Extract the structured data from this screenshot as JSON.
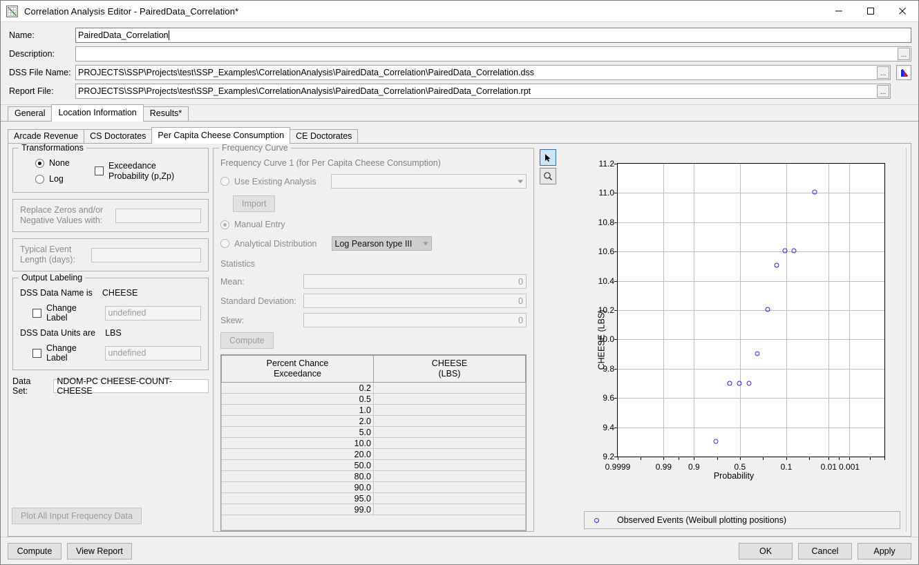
{
  "window": {
    "title": "Correlation Analysis Editor - PairedData_Correlation*",
    "icon": "correlation-chart-icon",
    "controls": {
      "minimize": "minimize-icon",
      "maximize": "maximize-icon",
      "close": "close-icon"
    }
  },
  "header": {
    "name_label": "Name:",
    "name_value": "PairedData_Correlation",
    "description_label": "Description:",
    "description_value": "",
    "dss_label": "DSS File Name:",
    "dss_value": "PROJECTS\\SSP\\Projects\\test\\SSP_Examples\\CorrelationAnalysis\\PairedData_Correlation\\PairedData_Correlation.dss",
    "report_label": "Report File:",
    "report_value": "PROJECTS\\SSP\\Projects\\test\\SSP_Examples\\CorrelationAnalysis\\PairedData_Correlation\\PairedData_Correlation.rpt",
    "browse_label": "...",
    "dist_icon": "distribution-plot-icon"
  },
  "main_tabs": [
    {
      "label": "General",
      "selected": false
    },
    {
      "label": "Location Information",
      "selected": true
    },
    {
      "label": "Results*",
      "selected": false
    }
  ],
  "sub_tabs": [
    {
      "label": "Arcade Revenue",
      "selected": false
    },
    {
      "label": "CS Doctorates",
      "selected": false
    },
    {
      "label": "Per Capita Cheese Consumption",
      "selected": true
    },
    {
      "label": "CE Doctorates",
      "selected": false
    }
  ],
  "transformations": {
    "group_label": "Transformations",
    "none_label": "None",
    "none_selected": true,
    "log_label": "Log",
    "log_selected": false,
    "exceedance_label_line1": "Exceedance",
    "exceedance_label_line2": "Probability (p,Zp)",
    "exceedance_checked": false
  },
  "replace_zeros": {
    "label_line1": "Replace Zeros and/or",
    "label_line2": "Negative Values with:",
    "value": ""
  },
  "typical_event": {
    "label_line1": "Typical Event",
    "label_line2": "Length (days):",
    "value": ""
  },
  "output_labeling": {
    "group_label": "Output Labeling",
    "data_name_label": "DSS Data Name is",
    "data_name_value": "CHEESE",
    "change_label_1": "Change Label",
    "change_label_1_checked": false,
    "change_label_1_value": "undefined",
    "data_units_label": "DSS Data Units are",
    "data_units_value": "LBS",
    "change_label_2": "Change Label",
    "change_label_2_checked": false,
    "change_label_2_value": "undefined"
  },
  "data_set": {
    "label": "Data Set:",
    "value": "NDOM-PC CHEESE-COUNT-CHEESE"
  },
  "plot_all_button": "Plot All Input Frequency Data",
  "frequency_curve": {
    "group_label": "Frequency Curve",
    "subtitle": "Frequency Curve 1 (for Per Capita Cheese Consumption)",
    "use_existing_label": "Use Existing Analysis",
    "use_existing_selected": false,
    "use_existing_value": "",
    "import_button": "Import",
    "manual_entry_label": "Manual Entry",
    "manual_entry_selected": true,
    "analytical_label": "Analytical Distribution",
    "analytical_selected": false,
    "distribution_value": "Log Pearson type III",
    "statistics_label": "Statistics",
    "mean_label": "Mean:",
    "mean_value": "0",
    "stddev_label": "Standard Deviation:",
    "stddev_value": "0",
    "skew_label": "Skew:",
    "skew_value": "0",
    "compute_button": "Compute"
  },
  "table": {
    "col1_header_line1": "Percent Chance",
    "col1_header_line2": "Exceedance",
    "col2_header_line1": "CHEESE",
    "col2_header_line2": "(LBS)",
    "rows": [
      {
        "pce": "0.2",
        "cheese": ""
      },
      {
        "pce": "0.5",
        "cheese": ""
      },
      {
        "pce": "1.0",
        "cheese": ""
      },
      {
        "pce": "2.0",
        "cheese": ""
      },
      {
        "pce": "5.0",
        "cheese": ""
      },
      {
        "pce": "10.0",
        "cheese": ""
      },
      {
        "pce": "20.0",
        "cheese": ""
      },
      {
        "pce": "50.0",
        "cheese": ""
      },
      {
        "pce": "80.0",
        "cheese": ""
      },
      {
        "pce": "90.0",
        "cheese": ""
      },
      {
        "pce": "95.0",
        "cheese": ""
      },
      {
        "pce": "99.0",
        "cheese": ""
      }
    ]
  },
  "chart_tools": [
    {
      "name": "pointer-tool",
      "selected": true
    },
    {
      "name": "zoom-tool",
      "selected": false
    }
  ],
  "chart_data": {
    "type": "scatter",
    "title": "",
    "xlabel": "Probability",
    "ylabel": "CHEESE (LBS)",
    "x_tick_labels": [
      "0.9999",
      "0.99",
      "0.9",
      "0.5",
      "0.1",
      "0.01",
      "0.001"
    ],
    "x_tick_positions": [
      0.0,
      0.172,
      0.286,
      0.458,
      0.632,
      0.791,
      0.868
    ],
    "y_tick_labels": [
      "9.2",
      "9.4",
      "9.6",
      "9.8",
      "10.0",
      "10.2",
      "10.4",
      "10.6",
      "10.8",
      "11.0",
      "11.2"
    ],
    "ylim": [
      9.2,
      11.2
    ],
    "grid": true,
    "legend_position": "bottom",
    "series": [
      {
        "name": "Observed Events (Weibull plotting positions)",
        "marker": "open-circle",
        "color": "#2727d6",
        "points": [
          {
            "probability": 0.9,
            "cheese": 9.3
          },
          {
            "probability": 0.8,
            "cheese": 9.7
          },
          {
            "probability": 0.7,
            "cheese": 9.7
          },
          {
            "probability": 0.6,
            "cheese": 9.7
          },
          {
            "probability": 0.5,
            "cheese": 9.9
          },
          {
            "probability": 0.45,
            "cheese": 10.2
          },
          {
            "probability": 0.35,
            "cheese": 10.5
          },
          {
            "probability": 0.27,
            "cheese": 10.6
          },
          {
            "probability": 0.22,
            "cheese": 10.6
          },
          {
            "probability": 0.1,
            "cheese": 11.0
          }
        ],
        "pixel_positions": [
          {
            "x": 0.367,
            "y": 9.305
          },
          {
            "x": 0.42,
            "y": 9.7
          },
          {
            "x": 0.456,
            "y": 9.7
          },
          {
            "x": 0.492,
            "y": 9.7
          },
          {
            "x": 0.524,
            "y": 9.905
          },
          {
            "x": 0.562,
            "y": 10.205
          },
          {
            "x": 0.597,
            "y": 10.505
          },
          {
            "x": 0.627,
            "y": 10.605
          },
          {
            "x": 0.66,
            "y": 10.605
          },
          {
            "x": 0.739,
            "y": 11.005
          }
        ]
      }
    ]
  },
  "legend": {
    "marker": "open-circle-marker",
    "text": "Observed Events (Weibull plotting positions)"
  },
  "footer": {
    "compute": "Compute",
    "view_report": "View Report",
    "ok": "OK",
    "cancel": "Cancel",
    "apply": "Apply"
  },
  "colors": {
    "marker": "#2727d6",
    "panel": "#f0f0f0",
    "selected_tool": "#cfe4f7"
  }
}
